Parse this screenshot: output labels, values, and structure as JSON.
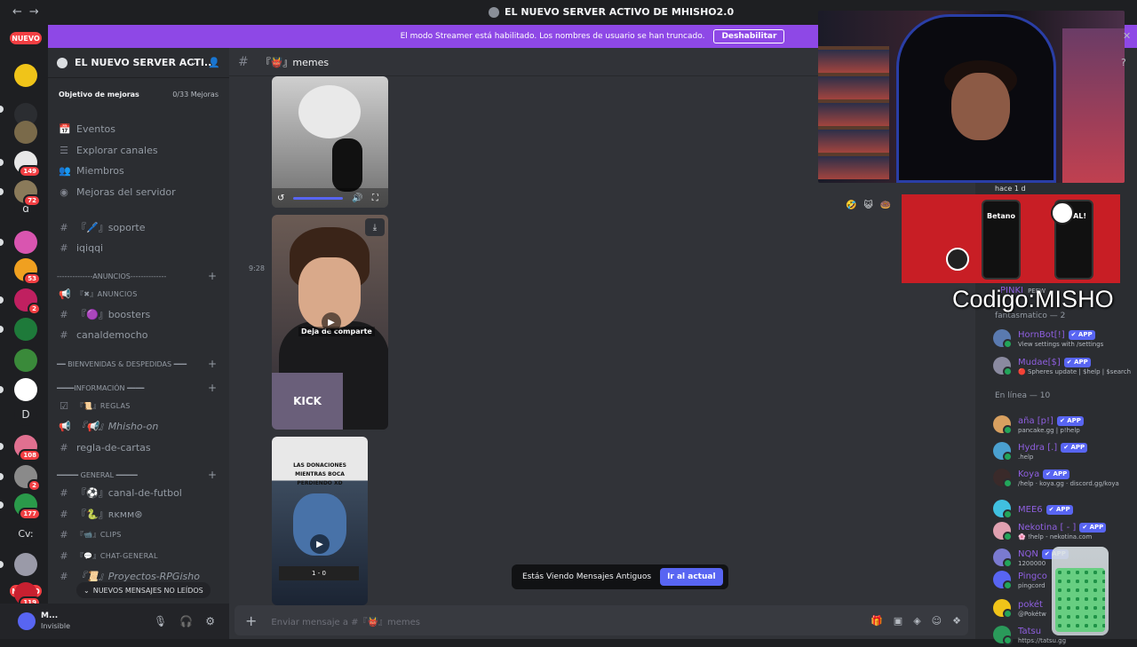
{
  "titlebar": {
    "back": "←",
    "forward": "→",
    "title": "EL NUEVO SERVER ACTIVO DE MHISHO2.0"
  },
  "banner": {
    "text": "El modo Streamer está habilitado. Los nombres de usuario se han truncado.",
    "button": "Deshabilitar"
  },
  "rail": {
    "new_top": "NUEVO",
    "new_bottom": "NUEVO",
    "servers": [
      {
        "badge": "",
        "color": "#f0c419"
      },
      {
        "badge": "",
        "color": "#2b2d31"
      },
      {
        "badge": "",
        "color": "#7a6a4a"
      },
      {
        "badge": "149",
        "color": "#e8e8e8"
      },
      {
        "badge": "72",
        "color": "#8a7a5a"
      },
      {
        "badge": "",
        "color": "#d955b0"
      },
      {
        "badge": "53",
        "color": "#f0a020"
      },
      {
        "badge": "2",
        "color": "#c02060"
      },
      {
        "badge": "",
        "color": "#1e7a3a"
      },
      {
        "badge": "",
        "color": "#3a8a3a"
      },
      {
        "badge": "",
        "color": "#ffffff"
      },
      {
        "badge": "108",
        "color": "#e07090"
      },
      {
        "badge": "2",
        "color": "#8a8a8a"
      },
      {
        "badge": "177",
        "color": "#2a9a4a"
      },
      {
        "badge": "",
        "color": "#9a9aa8"
      },
      {
        "badge": "119",
        "color": "#c82030"
      }
    ],
    "letters": {
      "d": "d",
      "D": "D",
      "cv": "Cv:"
    }
  },
  "sidebar": {
    "server_name": "EL NUEVO SERVER ACTI...",
    "boost_label": "Objetivo de mejoras",
    "boost_value": "0/33 Mejoras",
    "nav": [
      {
        "icon": "📅",
        "label": "Eventos"
      },
      {
        "icon": "☰",
        "label": "Explorar canales"
      },
      {
        "icon": "👥",
        "label": "Miembros"
      },
      {
        "icon": "◉",
        "label": "Mejoras del servidor"
      }
    ],
    "channels": [
      {
        "kind": "channel",
        "icon": "#",
        "label": "『🖊️』soporte",
        "small": false,
        "italic": false
      },
      {
        "kind": "channel",
        "icon": "#",
        "label": "iqiqqi",
        "small": false,
        "italic": false
      },
      {
        "kind": "category",
        "label": "--------------ANUNCIOS--------------"
      },
      {
        "kind": "channel",
        "icon": "📢",
        "label": "『✖』anuncios",
        "small": true,
        "italic": false
      },
      {
        "kind": "channel",
        "icon": "#",
        "label": "『🟣』boosters",
        "small": false,
        "italic": false
      },
      {
        "kind": "channel",
        "icon": "#",
        "label": "canaldemocho",
        "small": false,
        "italic": false
      },
      {
        "kind": "category",
        "label": "━━ BIENVENIDAS & DESPEDIDAS ━━━"
      },
      {
        "kind": "category",
        "label": "━━━━INFORMACIÓN ━━━━"
      },
      {
        "kind": "channel",
        "icon": "☑",
        "label": "『📜』reglas",
        "small": true,
        "italic": false
      },
      {
        "kind": "channel",
        "icon": "📢",
        "label": "『📢』Mhisho-on",
        "small": false,
        "italic": true
      },
      {
        "kind": "channel",
        "icon": "#",
        "label": "regla-de-cartas",
        "small": false,
        "italic": false
      },
      {
        "kind": "category",
        "label": "━━━━━ GENERAL ━━━━━"
      },
      {
        "kind": "channel",
        "icon": "#",
        "label": "『⚽』canal-de-futbol",
        "small": false,
        "italic": false
      },
      {
        "kind": "channel",
        "icon": "#",
        "label": "『🐍』ʀᴋᴍᴍ⊛",
        "small": false,
        "italic": false
      },
      {
        "kind": "channel",
        "icon": "#",
        "label": "『📹』clips",
        "small": true,
        "italic": false
      },
      {
        "kind": "channel",
        "icon": "#",
        "label": "『💬』chat-general",
        "small": true,
        "italic": false
      },
      {
        "kind": "channel",
        "icon": "#",
        "label": "『📜』Proyectos-RPGisho",
        "small": false,
        "italic": true
      }
    ],
    "new_messages": "NUEVOS MENSAJES NO LEÍDOS"
  },
  "user": {
    "name": "M...",
    "status": "Invisible"
  },
  "main": {
    "channel": "『👹』memes",
    "timestamp": "9:28",
    "video_caption": "Deja de comparte",
    "video_watermark": "KICK",
    "thumb_title": "LAS DONACIONES MIENTRAS BOCA PERDIENDO XD",
    "thumb_score": "1 - 0",
    "old_messages": "Estás Viendo Mensajes Antiguos",
    "jump_button": "Ir al actual",
    "composer_placeholder": "Enviar mensaje a #『👹』memes"
  },
  "members": {
    "top_partial": {
      "name": "PINKI",
      "extra": "PEEW"
    },
    "section1": "fantasmatico — 2",
    "section2": "En línea — 10",
    "list": [
      {
        "name": "HornBot[!]",
        "tag": "✔ APP",
        "status": "View settings with /settings",
        "color": "#5a7ab0"
      },
      {
        "name": "Mudae[$]",
        "tag": "✔ APP",
        "status": "🔴 Spheres update | $help | $search",
        "color": "#8a8aa0"
      },
      {
        "name": "aña [p!]",
        "tag": "✔ APP",
        "status": "pancake.gg | p!help",
        "color": "#d8a060"
      },
      {
        "name": "Hydra [.]",
        "tag": "✔ APP",
        "status": ".help",
        "color": "#4aa0d0"
      },
      {
        "name": "Koya",
        "tag": "✔ APP",
        "status": "/help · koya.gg · discord.gg/koya",
        "color": "#3a2a2a"
      },
      {
        "name": "MEE6",
        "tag": "✔ APP",
        "status": "",
        "color": "#40c0e0"
      },
      {
        "name": "Nekotina [ - ]",
        "tag": "✔ APP",
        "status": "🌸 !help - nekotina.com",
        "color": "#e0a0b0"
      },
      {
        "name": "NQN",
        "tag": "✔ APP",
        "status": "1200000",
        "color": "#7a7ad0"
      },
      {
        "name": "Pingco",
        "tag": "",
        "status": "pingcord",
        "color": "#5865f2"
      },
      {
        "name": "pokét",
        "tag": "",
        "status": "@Pokétw",
        "color": "#f0c419"
      },
      {
        "name": "Tatsu",
        "tag": "",
        "status": "https://tatsu.gg",
        "color": "#2a9a5a"
      }
    ]
  },
  "overlay": {
    "hace": "hace 1 d",
    "code": "Codigo:MISHO",
    "ad_brand": "Betano",
    "ad_goal": "GOAL!",
    "reactions": [
      "🤣",
      "😺",
      "🍩"
    ]
  },
  "colors": {
    "accent": "#5865f2",
    "streamer_banner": "#8e48e6",
    "alert": "#f23f43",
    "online": "#23a55a"
  }
}
